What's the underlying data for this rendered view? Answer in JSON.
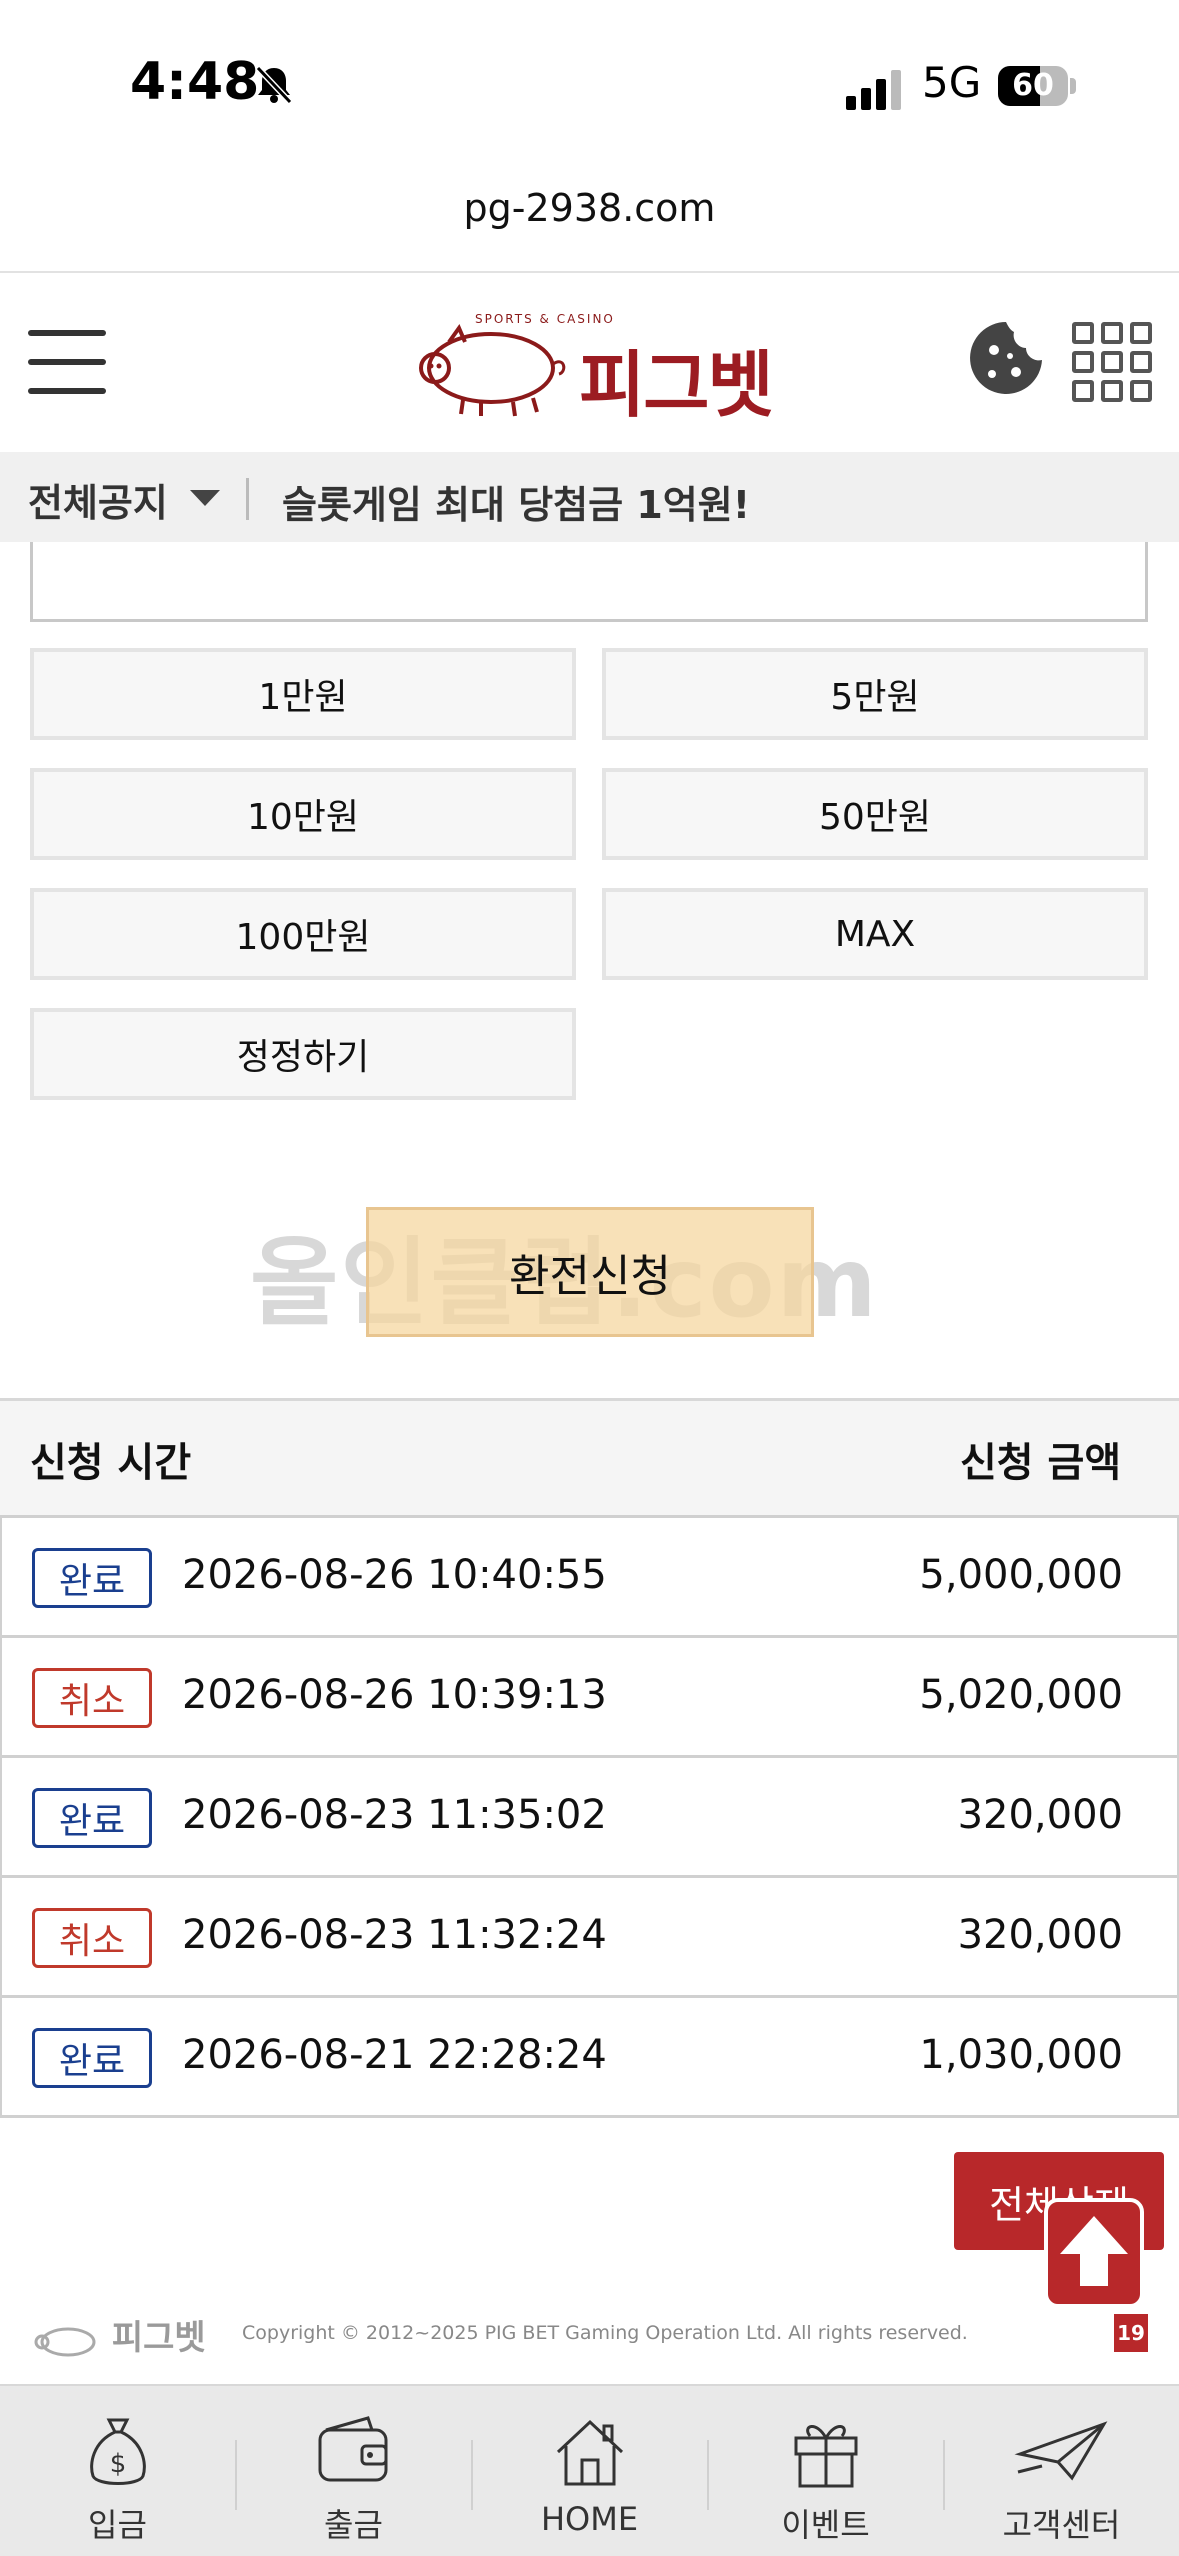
{
  "status_bar": {
    "time": "4:48",
    "network": "5G",
    "battery": "60",
    "battery_level": 0.6
  },
  "browser": {
    "url": "pg-2938.com"
  },
  "header": {
    "logo_text": "피그벳",
    "logo_sub": "SPORTS & CASINO"
  },
  "notice": {
    "label": "전체공지",
    "text": "슬롯게임 최대 당첨금 1억원!"
  },
  "amount_buttons": [
    "1만원",
    "5만원",
    "10만원",
    "50만원",
    "100만원",
    "MAX"
  ],
  "reset_button": "정정하기",
  "watermark": "올인클럽.com",
  "submit_button": "환전신청",
  "table": {
    "headers": {
      "time": "신청 시간",
      "amount": "신청 금액"
    },
    "rows": [
      {
        "status": "완료",
        "kind": "done",
        "date": "2026-08-26 10:40:55",
        "amount": "5,000,000"
      },
      {
        "status": "취소",
        "kind": "cancel",
        "date": "2026-08-26 10:39:13",
        "amount": "5,020,000"
      },
      {
        "status": "완료",
        "kind": "done",
        "date": "2026-08-23 11:35:02",
        "amount": "320,000"
      },
      {
        "status": "취소",
        "kind": "cancel",
        "date": "2026-08-23 11:32:24",
        "amount": "320,000"
      },
      {
        "status": "완료",
        "kind": "done",
        "date": "2026-08-21 22:28:24",
        "amount": "1,030,000"
      }
    ]
  },
  "delete_all_button": "전체삭제",
  "footer": {
    "logo_text": "피그벳",
    "copyright": "Copyright © 2012~2025 PIG BET Gaming Operation Ltd. All rights reserved.",
    "age_badge": "19"
  },
  "bottom_nav": [
    {
      "label": "입금",
      "icon": "money-bag-icon"
    },
    {
      "label": "출금",
      "icon": "wallet-icon"
    },
    {
      "label": "HOME",
      "icon": "home-icon"
    },
    {
      "label": "이벤트",
      "icon": "gift-icon"
    },
    {
      "label": "고객센터",
      "icon": "paper-plane-icon"
    }
  ],
  "colors": {
    "brand_red": "#b8282a",
    "done_blue": "#1a3f8f",
    "cancel_red": "#c0392b"
  }
}
